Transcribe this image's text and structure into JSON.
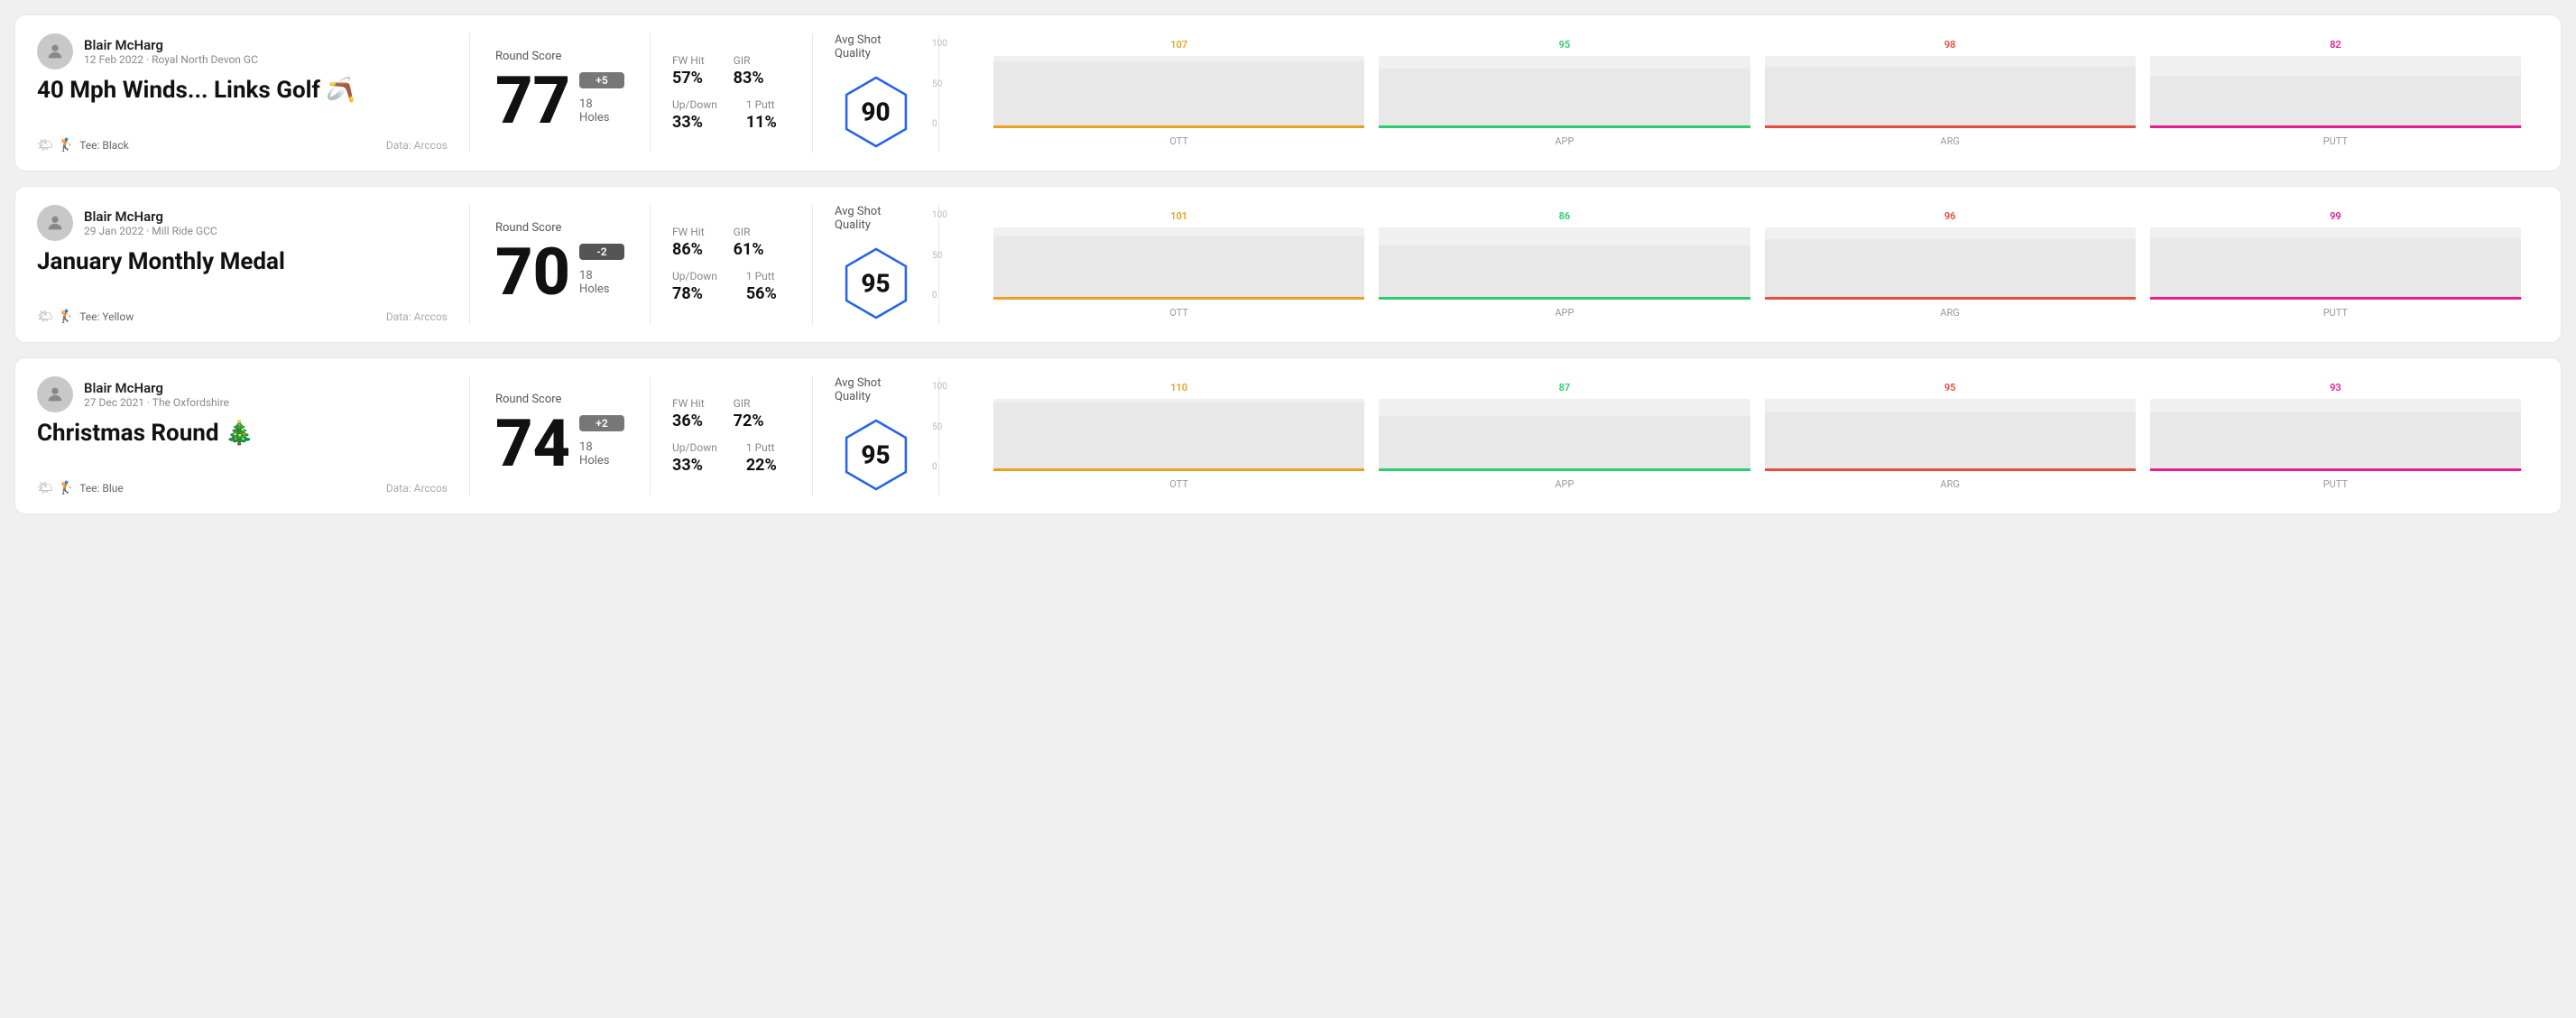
{
  "rounds": [
    {
      "id": "round1",
      "player_name": "Blair McHarg",
      "date_course": "12 Feb 2022 · Royal North Devon GC",
      "title": "40 Mph Winds... Links Golf 🪃",
      "tee": "Black",
      "data_source": "Data: Arccos",
      "score": "77",
      "score_modifier": "+5",
      "modifier_type": "positive",
      "holes": "18 Holes",
      "fw_hit": "57%",
      "gir": "83%",
      "up_down": "33%",
      "one_putt": "11%",
      "avg_shot_quality": "90",
      "chart": {
        "bars": [
          {
            "label": "OTT",
            "value": 107,
            "max": 120,
            "color": "#e8a020"
          },
          {
            "label": "APP",
            "value": 95,
            "max": 120,
            "color": "#2ecc71"
          },
          {
            "label": "ARG",
            "value": 98,
            "max": 120,
            "color": "#e74c3c"
          },
          {
            "label": "PUTT",
            "value": 82,
            "max": 120,
            "color": "#e91e8c"
          }
        ],
        "y_labels": [
          "100",
          "50",
          "0"
        ]
      }
    },
    {
      "id": "round2",
      "player_name": "Blair McHarg",
      "date_course": "29 Jan 2022 · Mill Ride GCC",
      "title": "January Monthly Medal",
      "tee": "Yellow",
      "data_source": "Data: Arccos",
      "score": "70",
      "score_modifier": "-2",
      "modifier_type": "negative",
      "holes": "18 Holes",
      "fw_hit": "86%",
      "gir": "61%",
      "up_down": "78%",
      "one_putt": "56%",
      "avg_shot_quality": "95",
      "chart": {
        "bars": [
          {
            "label": "OTT",
            "value": 101,
            "max": 120,
            "color": "#e8a020"
          },
          {
            "label": "APP",
            "value": 86,
            "max": 120,
            "color": "#2ecc71"
          },
          {
            "label": "ARG",
            "value": 96,
            "max": 120,
            "color": "#e74c3c"
          },
          {
            "label": "PUTT",
            "value": 99,
            "max": 120,
            "color": "#e91e8c"
          }
        ],
        "y_labels": [
          "100",
          "50",
          "0"
        ]
      }
    },
    {
      "id": "round3",
      "player_name": "Blair McHarg",
      "date_course": "27 Dec 2021 · The Oxfordshire",
      "title": "Christmas Round 🎄",
      "tee": "Blue",
      "data_source": "Data: Arccos",
      "score": "74",
      "score_modifier": "+2",
      "modifier_type": "positive",
      "holes": "18 Holes",
      "fw_hit": "36%",
      "gir": "72%",
      "up_down": "33%",
      "one_putt": "22%",
      "avg_shot_quality": "95",
      "chart": {
        "bars": [
          {
            "label": "OTT",
            "value": 110,
            "max": 120,
            "color": "#e8a020"
          },
          {
            "label": "APP",
            "value": 87,
            "max": 120,
            "color": "#2ecc71"
          },
          {
            "label": "ARG",
            "value": 95,
            "max": 120,
            "color": "#e74c3c"
          },
          {
            "label": "PUTT",
            "value": 93,
            "max": 120,
            "color": "#e91e8c"
          }
        ],
        "y_labels": [
          "100",
          "50",
          "0"
        ]
      }
    }
  ],
  "labels": {
    "round_score": "Round Score",
    "fw_hit": "FW Hit",
    "gir": "GIR",
    "up_down": "Up/Down",
    "one_putt": "1 Putt",
    "avg_shot_quality": "Avg Shot Quality",
    "tee_prefix": "Tee:",
    "data_prefix": "Data: Arccos"
  }
}
